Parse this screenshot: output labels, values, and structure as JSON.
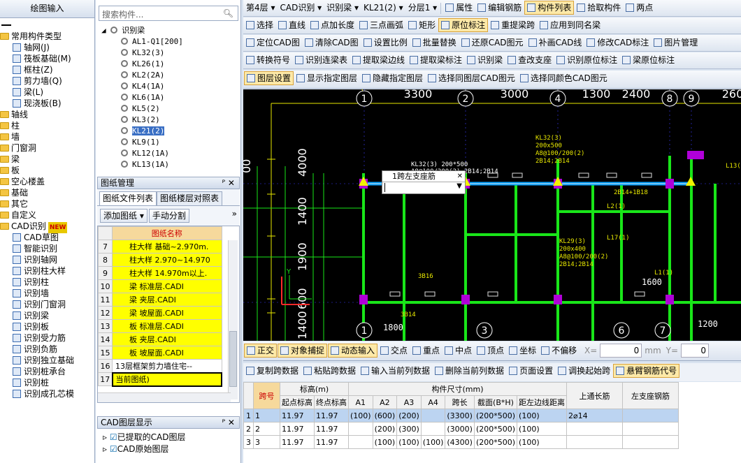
{
  "left_panel": {
    "title": "绘图输入",
    "tree": [
      {
        "label": "常用构件类型",
        "level": 0,
        "type": "folder"
      },
      {
        "label": "轴网(J)",
        "level": 1,
        "type": "item"
      },
      {
        "label": "筏板基础(M)",
        "level": 1,
        "type": "item"
      },
      {
        "label": "框柱(Z)",
        "level": 1,
        "type": "item"
      },
      {
        "label": "剪力墙(Q)",
        "level": 1,
        "type": "item"
      },
      {
        "label": "梁(L)",
        "level": 1,
        "type": "item"
      },
      {
        "label": "现浇板(B)",
        "level": 1,
        "type": "item"
      },
      {
        "label": "轴线",
        "level": 0,
        "type": "folder"
      },
      {
        "label": "柱",
        "level": 0,
        "type": "folder"
      },
      {
        "label": "墙",
        "level": 0,
        "type": "folder"
      },
      {
        "label": "门窗洞",
        "level": 0,
        "type": "folder"
      },
      {
        "label": "梁",
        "level": 0,
        "type": "folder"
      },
      {
        "label": "板",
        "level": 0,
        "type": "folder"
      },
      {
        "label": "空心楼盖",
        "level": 0,
        "type": "folder"
      },
      {
        "label": "基础",
        "level": 0,
        "type": "folder"
      },
      {
        "label": "其它",
        "level": 0,
        "type": "folder"
      },
      {
        "label": "自定义",
        "level": 0,
        "type": "folder"
      },
      {
        "label": "CAD识别",
        "level": 0,
        "type": "folder",
        "badge": "NEW"
      },
      {
        "label": "CAD草图",
        "level": 1,
        "type": "item"
      },
      {
        "label": "智能识别",
        "level": 1,
        "type": "item"
      },
      {
        "label": "识别轴网",
        "level": 1,
        "type": "item"
      },
      {
        "label": "识别柱大样",
        "level": 1,
        "type": "item"
      },
      {
        "label": "识别柱",
        "level": 1,
        "type": "item"
      },
      {
        "label": "识别墙",
        "level": 1,
        "type": "item"
      },
      {
        "label": "识别门窗洞",
        "level": 1,
        "type": "item"
      },
      {
        "label": "识别梁",
        "level": 1,
        "type": "item"
      },
      {
        "label": "识别板",
        "level": 1,
        "type": "item"
      },
      {
        "label": "识别受力筋",
        "level": 1,
        "type": "item"
      },
      {
        "label": "识别负筋",
        "level": 1,
        "type": "item"
      },
      {
        "label": "识别独立基础",
        "level": 1,
        "type": "item"
      },
      {
        "label": "识别桩承台",
        "level": 1,
        "type": "item"
      },
      {
        "label": "识别桩",
        "level": 1,
        "type": "item"
      },
      {
        "label": "识别成孔芯模",
        "level": 1,
        "type": "item"
      }
    ]
  },
  "component_panel": {
    "search_placeholder": "搜索构件...",
    "root": "识别梁",
    "items": [
      "AL1-Q1[200]",
      "KL32(3)",
      "KL26(1)",
      "KL2(2A)",
      "KL4(1A)",
      "KL6(1A)",
      "KL5(2)",
      "KL3(2)",
      "KL21(2)",
      "KL9(1)",
      "KL12(1A)",
      "KL13(1A)"
    ],
    "selected_index": 8
  },
  "drawing_panel": {
    "title": "图纸管理",
    "tabs": [
      "图纸文件列表",
      "图纸楼层对照表"
    ],
    "buttons": [
      "添加图纸",
      "手动分割"
    ],
    "column": "图纸名称",
    "rows": [
      {
        "no": "7",
        "name": "柱大样 基础~2.970m.",
        "hl": true
      },
      {
        "no": "8",
        "name": "柱大样 2.970~14.970",
        "hl": true
      },
      {
        "no": "9",
        "name": "柱大样 14.970m以上.",
        "hl": true
      },
      {
        "no": "10",
        "name": "梁 标准层.CADI",
        "hl": true
      },
      {
        "no": "11",
        "name": "梁 夹层.CADI",
        "hl": true
      },
      {
        "no": "12",
        "name": "梁 坡屋面.CADI",
        "hl": true
      },
      {
        "no": "13",
        "name": "板 标准层.CADI",
        "hl": true
      },
      {
        "no": "14",
        "name": "板 夹层.CADI",
        "hl": true
      },
      {
        "no": "15",
        "name": "板 坡屋面.CADI",
        "hl": true
      },
      {
        "no": "16",
        "name": "13层框架剪力墙住宅--",
        "hl": false
      },
      {
        "no": "17",
        "name": "当前图纸)",
        "hl": true
      }
    ]
  },
  "layer_panel": {
    "title": "CAD图层显示",
    "items": [
      "已提取的CAD图层",
      "CAD原始图层"
    ]
  },
  "toolbar1": {
    "floor": "第4层",
    "mode": "CAD识别",
    "type": "识别梁",
    "component": "KL21(2)",
    "layer": "分层1",
    "items": [
      "属性",
      "编辑钢筋",
      "构件列表",
      "拾取构件",
      "两点"
    ]
  },
  "toolbar2": {
    "items": [
      "选择",
      "直线",
      "点加长度",
      "三点画弧",
      "矩形",
      "原位标注",
      "重提梁跨",
      "应用到同名梁"
    ]
  },
  "toolbar3": {
    "items": [
      "定位CAD图",
      "清除CAD图",
      "设置比例",
      "批量替换",
      "还原CAD图元",
      "补画CAD线",
      "修改CAD标注",
      "图片管理"
    ]
  },
  "toolbar4": {
    "items": [
      "转换符号",
      "识别连梁表",
      "提取梁边线",
      "提取梁标注",
      "识别梁",
      "查改支座",
      "识别原位标注",
      "梁原位标注"
    ]
  },
  "toolbar5": {
    "items": [
      "图层设置",
      "显示指定图层",
      "隐藏指定图层",
      "选择同图层CAD图元",
      "选择同颜色CAD图元"
    ]
  },
  "cad": {
    "top_dims": [
      "3300",
      "3000",
      "1300",
      "2400",
      "260"
    ],
    "axis_top": [
      "1",
      "2",
      "4",
      "8",
      "9"
    ],
    "axis_bottom": [
      "1",
      "3",
      "6",
      "7"
    ],
    "left_dims": [
      "4000",
      "1400",
      "1900",
      "600",
      "1400",
      "00"
    ],
    "popup_title": "1跨左支座筋",
    "labels": [
      {
        "t": "KL32(3) 200*500"
      },
      {
        "t": "A8@100/200(2) 2B14;2B14"
      },
      {
        "t": "KL32(3)"
      },
      {
        "t": "200x500"
      },
      {
        "t": "A8@100/200(2)"
      },
      {
        "t": "2B14;2B14"
      },
      {
        "t": "2B14+1B18"
      },
      {
        "t": "L17(1)"
      },
      {
        "t": "KL29(3)"
      },
      {
        "t": "200x400"
      },
      {
        "t": "A8@100/200(2)"
      },
      {
        "t": "2B14;2B14"
      },
      {
        "t": "1600"
      },
      {
        "t": "1800"
      },
      {
        "t": "1200"
      },
      {
        "t": "3B14"
      },
      {
        "t": "3B16"
      },
      {
        "t": "L1(1)"
      },
      {
        "t": "L2(1)"
      },
      {
        "t": "L13(1)"
      }
    ]
  },
  "snapbar": {
    "items": [
      "正交",
      "对象捕捉",
      "动态输入",
      "交点",
      "重点",
      "中点",
      "顶点",
      "坐标",
      "不偏移"
    ],
    "x_label": "X=",
    "x_value": "0",
    "unit": "mm",
    "y_label": "Y=",
    "y_value": "0"
  },
  "span_toolbar": {
    "items": [
      "复制跨数据",
      "粘贴跨数据",
      "输入当前列数据",
      "删除当前列数据",
      "页面设置",
      "调换起始跨",
      "悬臂钢筋代号"
    ]
  },
  "grid": {
    "h_span": "跨号",
    "h_elev": "标高(m)",
    "h_dims": "构件尺寸(mm)",
    "h_top": "上通长筋",
    "h_left": "左支座钢筋",
    "sub": [
      "起点标高",
      "终点标高",
      "A1",
      "A2",
      "A3",
      "A4",
      "跨长",
      "截面(B*H)",
      "距左边线距离"
    ],
    "rows": [
      [
        "1",
        "1",
        "11.97",
        "11.97",
        "(100)",
        "(600)",
        "(200)",
        "",
        "(3300)",
        "(200*500)",
        "(100)",
        "2⌀14",
        ""
      ],
      [
        "2",
        "2",
        "11.97",
        "11.97",
        "",
        "(200)",
        "(300)",
        "",
        "(3000)",
        "(200*500)",
        "(100)",
        "",
        ""
      ],
      [
        "3",
        "3",
        "11.97",
        "11.97",
        "",
        "(100)",
        "(100)",
        "(100)",
        "(4300)",
        "(200*500)",
        "(100)",
        "",
        ""
      ]
    ]
  }
}
